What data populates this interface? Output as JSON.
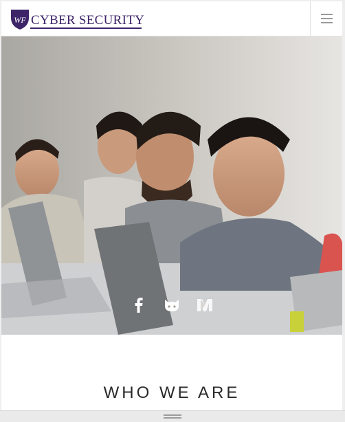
{
  "header": {
    "logo_text": "CYBER SECURITY",
    "logo_monogram": "WF",
    "brand_color": "#3d2468",
    "menu_icon": "hamburger-icon"
  },
  "hero": {
    "image": "students-working-on-laptops-photo",
    "social": [
      {
        "name": "facebook",
        "icon": "facebook-icon"
      },
      {
        "name": "github",
        "icon": "github-icon"
      },
      {
        "name": "medium",
        "icon": "medium-icon"
      }
    ]
  },
  "section": {
    "title": "WHO WE ARE"
  },
  "footer": {
    "handle_icon": "drag-handle-icon"
  }
}
